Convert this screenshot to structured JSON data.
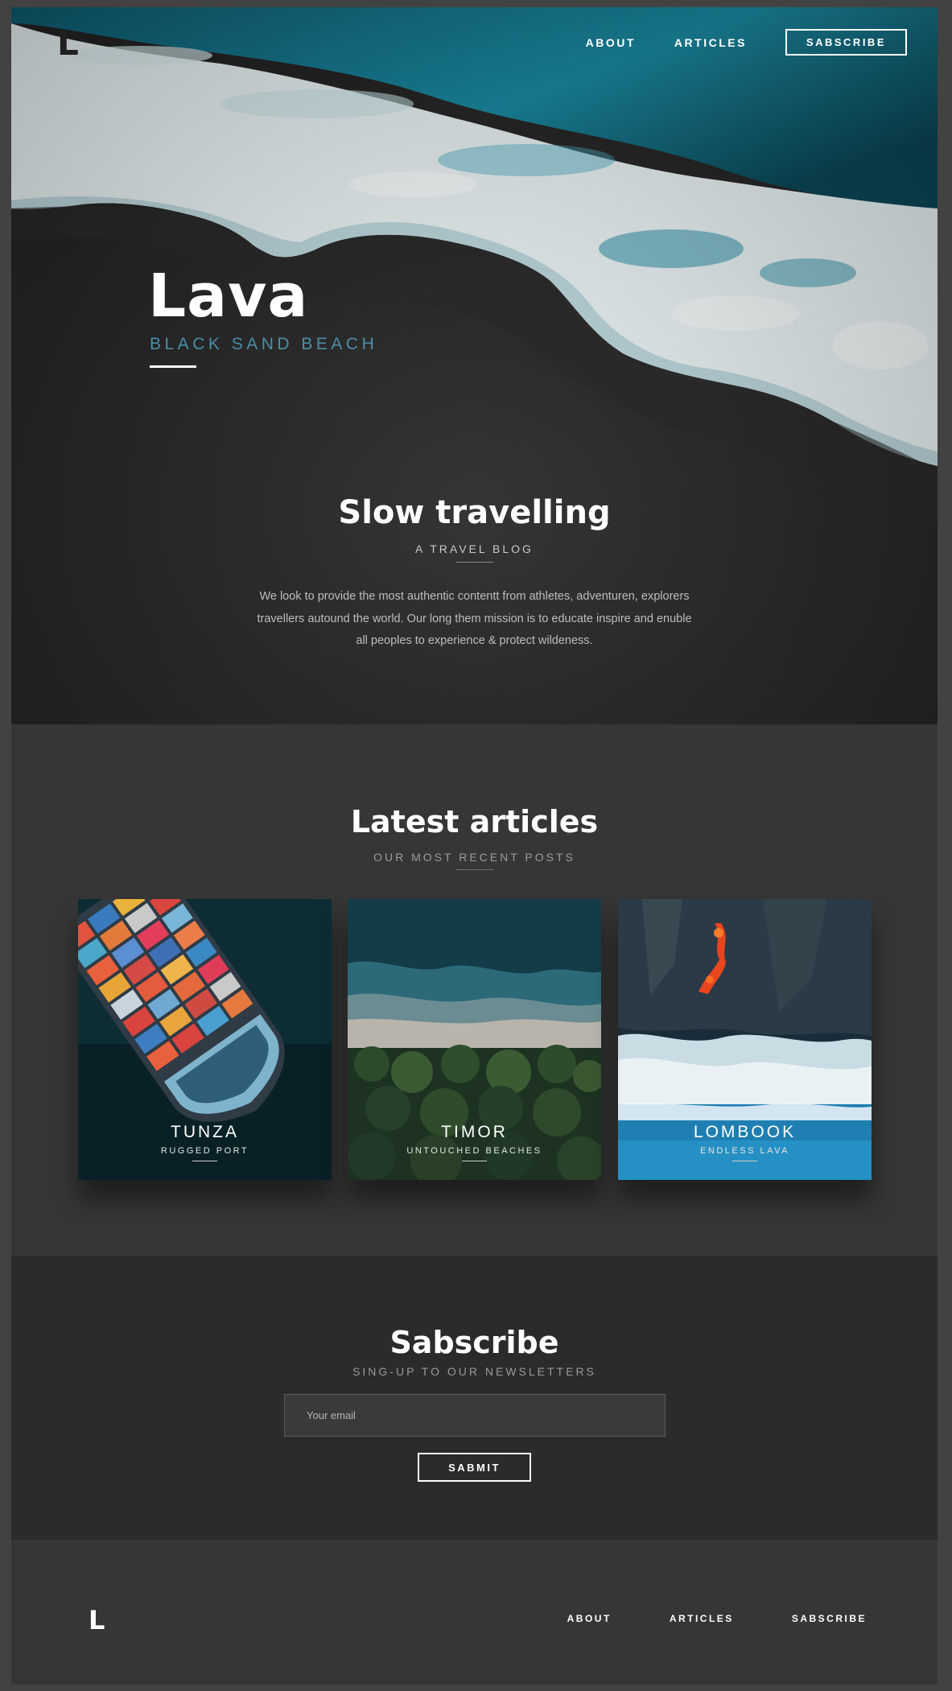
{
  "header": {
    "logo": "L",
    "nav": [
      "ABOUT",
      "ARTICLES"
    ],
    "subscribe_label": "SABSCRIBE"
  },
  "hero": {
    "title": "Lava",
    "subtitle": "BLACK SAND BEACH"
  },
  "intro": {
    "title": "Slow travelling",
    "subtitle": "A TRAVEL BLOG",
    "text": "We look to provide the most authentic contentt from  athletes, adventuren, explorers travellers autound the world. Our long them mission is to educate inspire and enuble all peoples to experience & protect wildeness."
  },
  "articles": {
    "title": "Latest articles",
    "subtitle": "OUR MOST RECENT POSTS",
    "cards": [
      {
        "title": "TUNZA",
        "subtitle": "RUGGED PORT"
      },
      {
        "title": "TIMOR",
        "subtitle": "UNTOUCHED BEACHES"
      },
      {
        "title": "LOMBOOK",
        "subtitle": "ENDLESS LAVA"
      }
    ]
  },
  "subscribe": {
    "title": "Sabscribe",
    "subtitle": "SING-UP TO OUR NEWSLETTERS",
    "email_placeholder": "Your email",
    "submit_label": "SABMIT"
  },
  "footer": {
    "logo": "L",
    "nav": [
      "ABOUT",
      "ARTICLES",
      "SABSCRIBE"
    ]
  },
  "colors": {
    "page_background": "#363636",
    "accent": "#4b8ea8",
    "subscribe_background": "#2b2b2b",
    "ocean": "#1b8ba3"
  }
}
